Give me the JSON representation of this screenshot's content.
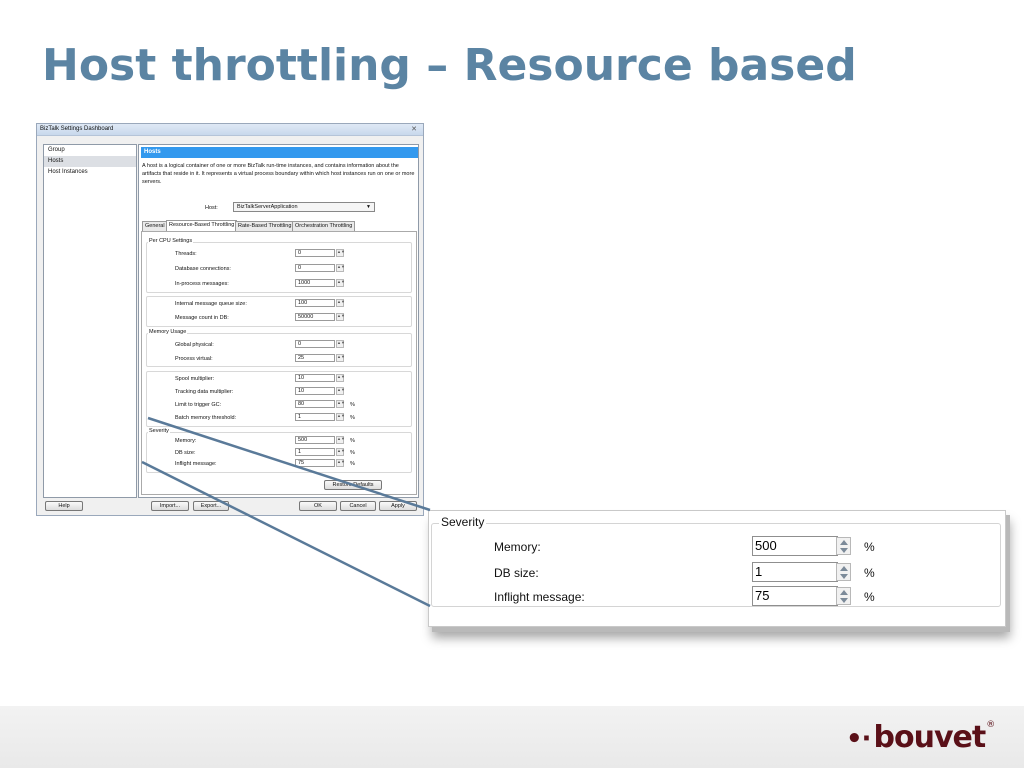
{
  "slide": {
    "title": "Host throttling – Resource based",
    "logo_text": "bouvet",
    "logo_mark": "®"
  },
  "dialog": {
    "title": "BizTalk Settings Dashboard",
    "close_glyph": "✕",
    "nav_items": [
      "Group",
      "Hosts",
      "Host Instances"
    ],
    "selected_nav": "Hosts",
    "panel_header": "Hosts",
    "description": "A host is a logical container of one or more BizTalk run-time instances, and contains information about the artifacts that reside in it. It represents a virtual process boundary within which host instances run on one or more servers.",
    "host_label": "Host:",
    "host_value": "BizTalkServerApplication",
    "tabs": [
      "General",
      "Resource-Based Throttling",
      "Rate-Based Throttling",
      "Orchestration Throttling"
    ],
    "active_tab": "Resource-Based Throttling",
    "per_cpu": {
      "title": "Per CPU Settings",
      "threads_label": "Threads:",
      "threads": "0",
      "db_conn_label": "Database connections:",
      "db_conn": "0",
      "inproc_label": "In-process messages:",
      "inproc": "1000"
    },
    "queue": {
      "queue_size_label": "Internal message queue size:",
      "queue_size": "100",
      "msg_count_label": "Message count in DB:",
      "msg_count": "50000"
    },
    "memory_usage": {
      "title": "Memory Usage",
      "global_label": "Global physical:",
      "global": "0",
      "process_label": "Process virtual:",
      "process": "25"
    },
    "misc": {
      "spool_label": "Spool multiplier:",
      "spool": "10",
      "tracking_label": "Tracking data multiplier:",
      "tracking": "10",
      "gc_label": "Limit to trigger GC:",
      "gc": "80",
      "batch_label": "Batch memory threshold:",
      "batch": "1"
    },
    "severity": {
      "title": "Severity",
      "memory_label": "Memory:",
      "memory": "500",
      "db_label": "DB size:",
      "db": "1",
      "inflight_label": "Inflight message:",
      "inflight": "75"
    },
    "percent": "%",
    "buttons": {
      "restore": "Restore Defaults",
      "help": "Help",
      "import": "Import...",
      "export": "Export...",
      "ok": "OK",
      "cancel": "Cancel",
      "apply": "Apply"
    }
  },
  "zoom": {
    "title": "Severity",
    "memory_label": "Memory:",
    "memory": "500",
    "db_label": "DB size:",
    "db": "1",
    "inflight_label": "Inflight message:",
    "inflight": "75",
    "percent": "%"
  }
}
